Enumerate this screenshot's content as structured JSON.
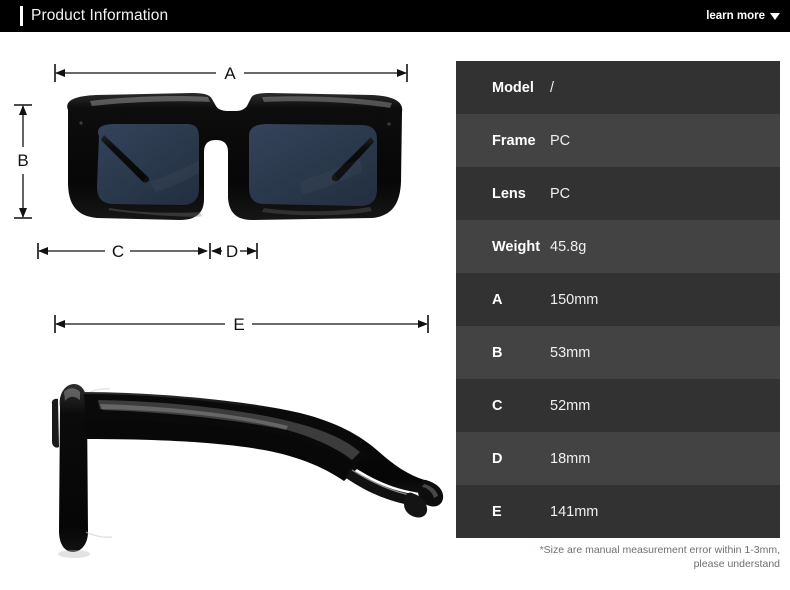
{
  "header": {
    "title": "Product Information",
    "learn_more_label": "learn more",
    "caret_icon": "chevron-down-icon",
    "background_color": "#000000",
    "accent_color": "#ffffff"
  },
  "diagram": {
    "front_view": {
      "name": "sunglasses-front-view",
      "frame_color": "#0b0b0b",
      "lens_color": "#2b3a4d",
      "dimension_labels": [
        "A",
        "B",
        "C",
        "D"
      ]
    },
    "side_view": {
      "name": "sunglasses-side-view",
      "frame_color": "#0b0b0b",
      "dimension_labels": [
        "E"
      ]
    },
    "labels": {
      "a": "A",
      "b": "B",
      "c": "C",
      "d": "D",
      "e": "E"
    }
  },
  "spec_table": {
    "row_color_odd": "#323232",
    "row_color_even": "#434343",
    "rows": [
      {
        "label": "Model",
        "value": "/"
      },
      {
        "label": "Frame",
        "value": "PC"
      },
      {
        "label": "Lens",
        "value": "PC"
      },
      {
        "label": "Weight",
        "value": "45.8g"
      },
      {
        "label": "A",
        "value": "150mm"
      },
      {
        "label": "B",
        "value": "53mm"
      },
      {
        "label": "C",
        "value": "52mm"
      },
      {
        "label": "D",
        "value": "18mm"
      },
      {
        "label": "E",
        "value": "141mm"
      }
    ]
  },
  "footnote": {
    "asterisk": "*",
    "line1": "Size are manual measurement error within 1-3mm,",
    "line2": "please understand",
    "asterisk_color": "#e8414a"
  }
}
